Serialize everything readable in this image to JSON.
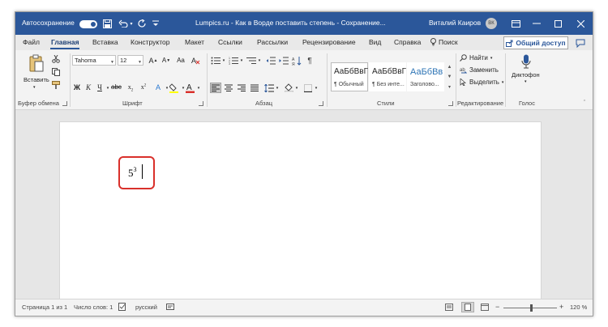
{
  "titlebar": {
    "autosave_label": "Автосохранение",
    "doc_title": "Lumpics.ru - Как в Ворде поставить степень - Сохранение...",
    "user_name": "Виталий Каиров",
    "user_initials": "ВК"
  },
  "tabs": {
    "items": [
      "Файл",
      "Главная",
      "Вставка",
      "Конструктор",
      "Макет",
      "Ссылки",
      "Рассылки",
      "Рецензирование",
      "Вид",
      "Справка"
    ],
    "search": "Поиск",
    "share": "Общий доступ"
  },
  "ribbon": {
    "clipboard": {
      "label": "Буфер обмена",
      "paste": "Вставить"
    },
    "font": {
      "label": "Шрифт",
      "name": "Tahoma",
      "size": "12"
    },
    "paragraph": {
      "label": "Абзац"
    },
    "styles": {
      "label": "Стили",
      "items": [
        {
          "sample": "АаБбВвГ",
          "name": "¶ Обычный"
        },
        {
          "sample": "АаБбВвГ",
          "name": "¶ Без инте..."
        },
        {
          "sample": "АаБбВв",
          "name": "Заголово..."
        }
      ]
    },
    "editing": {
      "label": "Редактирование",
      "find": "Найти",
      "replace": "Заменить",
      "select": "Выделить"
    },
    "voice": {
      "label": "Голос",
      "dictate": "Диктофон"
    }
  },
  "document": {
    "base": "5",
    "exponent": "3"
  },
  "statusbar": {
    "page": "Страница 1 из 1",
    "words": "Число слов: 1",
    "language": "русский",
    "zoom": "120 %"
  }
}
